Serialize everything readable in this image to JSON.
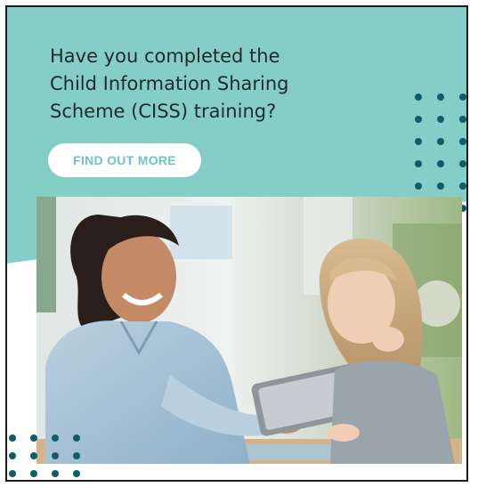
{
  "banner": {
    "headline": "Have you completed the\nChild Information Sharing\nScheme (CISS) training?",
    "cta_label": "FIND OUT MORE"
  },
  "colors": {
    "background_teal": "#85cec8",
    "button_text": "#6fc4bd",
    "dot_color": "#0d5e6a",
    "headline_text": "#1f2a2c"
  },
  "icons": {
    "dot_pattern": "dot-grid-decoration"
  }
}
